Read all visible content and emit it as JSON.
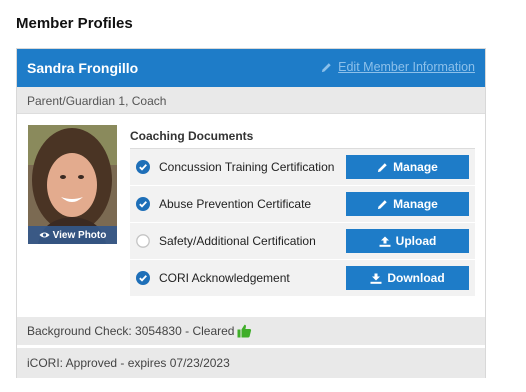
{
  "page": {
    "section_title": "Member Profiles"
  },
  "member": {
    "name": "Sandra Frongillo",
    "edit_link_label": "Edit Member Information",
    "roles": "Parent/Guardian 1, Coach",
    "photo_button_label": "View Photo"
  },
  "documents": {
    "title": "Coaching Documents",
    "items": [
      {
        "name": "Concussion Training Certification",
        "completed": true,
        "action_label": "Manage",
        "action_icon": "pencil-icon"
      },
      {
        "name": "Abuse Prevention Certificate",
        "completed": true,
        "action_label": "Manage",
        "action_icon": "pencil-icon"
      },
      {
        "name": "Safety/Additional Certification",
        "completed": false,
        "action_label": "Upload",
        "action_icon": "upload-icon"
      },
      {
        "name": "CORI Acknowledgement",
        "completed": true,
        "action_label": "Download",
        "action_icon": "download-icon"
      }
    ]
  },
  "status": {
    "background_check": "Background Check: 3054830 - Cleared",
    "icori": "iCORI: Approved - expires 07/23/2023"
  },
  "colors": {
    "primary_blue": "#1e7cc8",
    "header_link": "#8cc0ea",
    "check_blue": "#1e6fb8",
    "cleared_green": "#3fae29",
    "row_gray": "#f2f2f2",
    "bar_gray": "#e9e9e9"
  }
}
